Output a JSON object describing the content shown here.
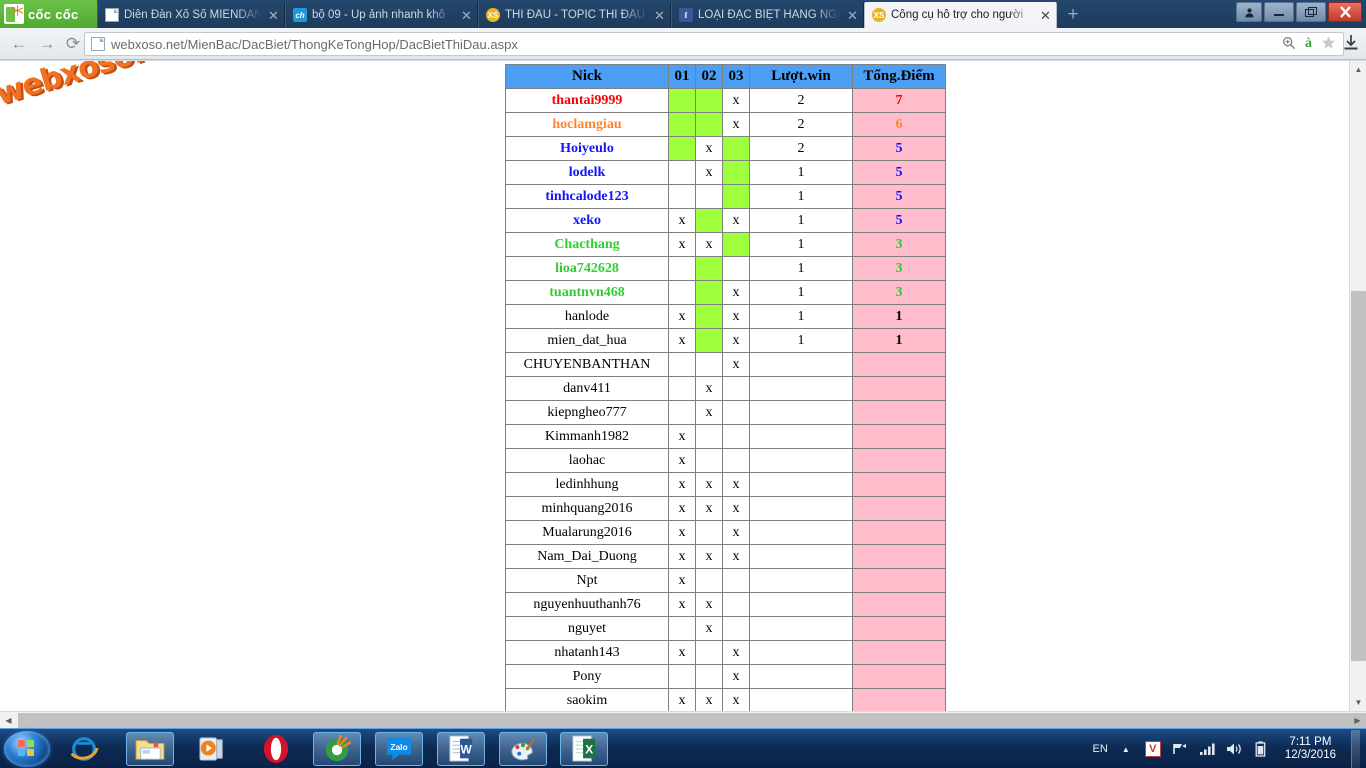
{
  "browser": {
    "brand": "cốc cốc",
    "tabs": [
      {
        "title": "Diễn Đàn Xổ Số MIENDAN",
        "favicon": "page-icon",
        "active": false
      },
      {
        "title": "bộ 09 - Up ảnh nhanh khô",
        "favicon": "ch-icon",
        "active": false
      },
      {
        "title": "THI ĐẤU - TOPIC THI ĐẤU",
        "favicon": "xs-icon",
        "active": false
      },
      {
        "title": "LOẠI ĐẶC BIỆT HÀNG NGÀ",
        "favicon": "fb-icon",
        "active": false
      },
      {
        "title": "Công cụ hỗ trợ cho người",
        "favicon": "xs-icon",
        "active": true
      }
    ],
    "new_tab_label": "+",
    "close_label": "✕",
    "window_controls": {
      "user": "\u0001",
      "minimize": "–",
      "restore": "❐",
      "close": "✕"
    },
    "nav": {
      "back": "←",
      "forward": "→",
      "reload": "⟳"
    },
    "url": "webxoso.net/MienBac/DacBiet/ThongKeTongHop/DacBietThiDau.aspx",
    "omnibox_icons": [
      "page-icon",
      "zoom-icon",
      "translate-icon",
      "bookmark-star-icon",
      "download-icon"
    ]
  },
  "page": {
    "watermark": "webxoso.net",
    "table": {
      "columns": [
        "Nick",
        "01",
        "02",
        "03",
        "Lượt.win",
        "Tổng.Điểm"
      ],
      "rows": [
        {
          "nick": "thantai9999",
          "color": "#ff0000",
          "c01": "green",
          "c02": "green",
          "c03": "x",
          "win": "2",
          "pt": "7"
        },
        {
          "nick": "hoclamgiau",
          "color": "#ff8533",
          "c01": "green",
          "c02": "green",
          "c03": "x",
          "win": "2",
          "pt": "6"
        },
        {
          "nick": "Hoiyeulo",
          "color": "#1414ff",
          "c01": "green",
          "c02": "x",
          "c03": "green",
          "win": "2",
          "pt": "5"
        },
        {
          "nick": "lodelk",
          "color": "#1414ff",
          "c01": "",
          "c02": "x",
          "c03": "green",
          "win": "1",
          "pt": "5"
        },
        {
          "nick": "tinhcalode123",
          "color": "#1414ff",
          "c01": "",
          "c02": "",
          "c03": "green",
          "win": "1",
          "pt": "5"
        },
        {
          "nick": "xeko",
          "color": "#1414ff",
          "c01": "x",
          "c02": "green",
          "c03": "x",
          "win": "1",
          "pt": "5"
        },
        {
          "nick": "Chacthang",
          "color": "#33cc33",
          "c01": "x",
          "c02": "x",
          "c03": "green",
          "win": "1",
          "pt": "3"
        },
        {
          "nick": "lioa742628",
          "color": "#33cc33",
          "c01": "",
          "c02": "green",
          "c03": "",
          "win": "1",
          "pt": "3"
        },
        {
          "nick": "tuantnvn468",
          "color": "#33cc33",
          "c01": "",
          "c02": "green",
          "c03": "x",
          "win": "1",
          "pt": "3"
        },
        {
          "nick": "hanlode",
          "color": "#000000",
          "c01": "x",
          "c02": "green",
          "c03": "x",
          "win": "1",
          "pt": "1"
        },
        {
          "nick": "mien_dat_hua",
          "color": "#000000",
          "c01": "x",
          "c02": "green",
          "c03": "x",
          "win": "1",
          "pt": "1"
        },
        {
          "nick": "CHUYENBANTHAN",
          "color": "#000000",
          "c01": "",
          "c02": "",
          "c03": "x",
          "win": "",
          "pt": ""
        },
        {
          "nick": "danv411",
          "color": "#000000",
          "c01": "",
          "c02": "x",
          "c03": "",
          "win": "",
          "pt": ""
        },
        {
          "nick": "kiepngheo777",
          "color": "#000000",
          "c01": "",
          "c02": "x",
          "c03": "",
          "win": "",
          "pt": ""
        },
        {
          "nick": "Kimmanh1982",
          "color": "#000000",
          "c01": "x",
          "c02": "",
          "c03": "",
          "win": "",
          "pt": ""
        },
        {
          "nick": "laohac",
          "color": "#000000",
          "c01": "x",
          "c02": "",
          "c03": "",
          "win": "",
          "pt": ""
        },
        {
          "nick": "ledinhhung",
          "color": "#000000",
          "c01": "x",
          "c02": "x",
          "c03": "x",
          "win": "",
          "pt": ""
        },
        {
          "nick": "minhquang2016",
          "color": "#000000",
          "c01": "x",
          "c02": "x",
          "c03": "x",
          "win": "",
          "pt": ""
        },
        {
          "nick": "Mualarung2016",
          "color": "#000000",
          "c01": "x",
          "c02": "",
          "c03": "x",
          "win": "",
          "pt": ""
        },
        {
          "nick": "Nam_Dai_Duong",
          "color": "#000000",
          "c01": "x",
          "c02": "x",
          "c03": "x",
          "win": "",
          "pt": ""
        },
        {
          "nick": "Npt",
          "color": "#000000",
          "c01": "x",
          "c02": "",
          "c03": "",
          "win": "",
          "pt": ""
        },
        {
          "nick": "nguyenhuuthanh76",
          "color": "#000000",
          "c01": "x",
          "c02": "x",
          "c03": "",
          "win": "",
          "pt": ""
        },
        {
          "nick": "nguyet",
          "color": "#000000",
          "c01": "",
          "c02": "x",
          "c03": "",
          "win": "",
          "pt": ""
        },
        {
          "nick": "nhatanh143",
          "color": "#000000",
          "c01": "x",
          "c02": "",
          "c03": "x",
          "win": "",
          "pt": ""
        },
        {
          "nick": "Pony",
          "color": "#000000",
          "c01": "",
          "c02": "",
          "c03": "x",
          "win": "",
          "pt": ""
        },
        {
          "nick": "saokim",
          "color": "#000000",
          "c01": "x",
          "c02": "x",
          "c03": "x",
          "win": "",
          "pt": ""
        }
      ],
      "colors": {
        "header_bg": "#4d9ff5",
        "mark_bg": "#9eff3c",
        "points_bg": "#ffbdcb",
        "border": "#808080"
      }
    }
  },
  "taskbar": {
    "start_label": "Start",
    "items": [
      {
        "name": "internet-explorer",
        "boxed": false
      },
      {
        "name": "file-explorer",
        "boxed": true
      },
      {
        "name": "media-player",
        "boxed": false
      },
      {
        "name": "opera",
        "boxed": false
      },
      {
        "name": "coccoc",
        "boxed": true
      },
      {
        "name": "zalo",
        "boxed": true
      },
      {
        "name": "word",
        "boxed": true
      },
      {
        "name": "paint",
        "boxed": true
      },
      {
        "name": "excel",
        "boxed": true
      }
    ],
    "tray": {
      "language": "EN",
      "show_hidden": "▲",
      "antivirus": "V",
      "network": "network-icon",
      "signal": "signal-icon",
      "volume": "volume-icon",
      "battery": "battery-icon",
      "time": "7:11 PM",
      "date": "12/3/2016"
    }
  }
}
